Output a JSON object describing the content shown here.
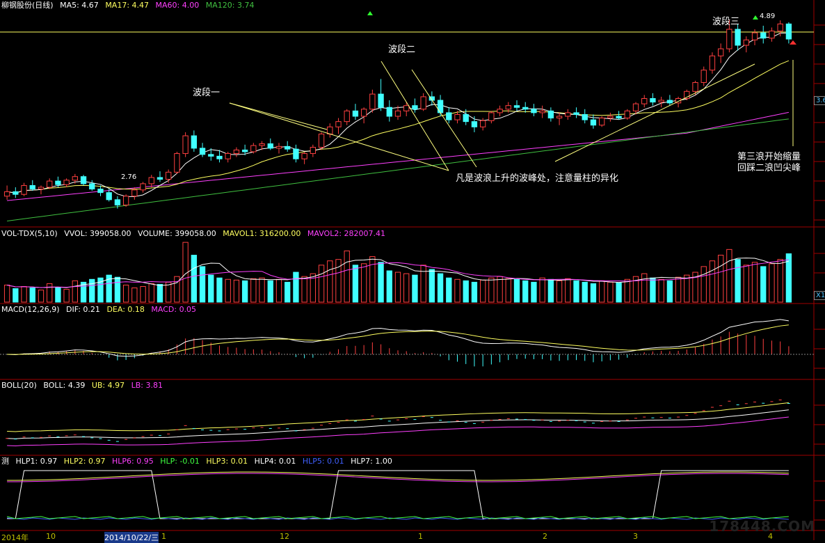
{
  "colors": {
    "up": "#ff4040",
    "down": "#40ffff",
    "ma5": "#ffffff",
    "ma17": "#ffff60",
    "ma60": "#ff40ff",
    "ma120": "#40c040",
    "axis": "#a00000"
  },
  "header": {
    "price": {
      "name": "柳钢股份(日线)",
      "ma5": "MA5: 4.67",
      "ma17": "MA17: 4.47",
      "ma60": "MA60: 4.00",
      "ma120": "MA120: 3.74"
    },
    "vol": {
      "name": "VOL-TDX(5,10)",
      "vvol": "VVOL: 399058.00",
      "volume": "VOLUME: 399058.00",
      "mavol1": "MAVOL1: 316200.00",
      "mavol2": "MAVOL2: 282007.41"
    },
    "macd": {
      "name": "MACD(12,26,9)",
      "dif": "DIF: 0.21",
      "dea": "DEA: 0.18",
      "macd": "MACD: 0.05"
    },
    "boll": {
      "name": "BOLL(20)",
      "boll": "BOLL: 4.39",
      "ub": "UB: 4.97",
      "lb": "LB: 3.81"
    },
    "hlp": {
      "name": "测",
      "hlp1": "HLP1: 0.97",
      "hlp2": "HLP2: 0.97",
      "hlp6": "HLP6: 0.95",
      "hlp": "HLP: -0.01",
      "hlp3": "HLP3: 0.01",
      "hlp4": "HLP4: 0.01",
      "hlp5": "HLP5: 0.01",
      "hlp7": "HLP7: 1.00"
    }
  },
  "annotations": {
    "wave1": "波段一",
    "wave2": "波段二",
    "wave3": "波段三",
    "note_main": "凡是波浪上升的波峰处，注意量柱的异化",
    "note_right_1": "第三浪开始缩量",
    "note_right_2": "回踩二浪凹尖峰",
    "low_label": "2.76",
    "high_label": "4.89"
  },
  "right_tags": {
    "price": "3.6",
    "vol": "X1"
  },
  "x_labels": [
    "2014年",
    "10",
    "2014/10/22/三",
    "1",
    "12",
    "1",
    "2",
    "3",
    "4"
  ],
  "watermark": "178448.COM",
  "chart_data": {
    "type": "candlestick",
    "title": "柳钢股份(日线)",
    "ohlc": [
      [
        2.9,
        3.02,
        2.86,
        2.95
      ],
      [
        2.95,
        3.0,
        2.88,
        2.92
      ],
      [
        2.92,
        3.05,
        2.9,
        3.02
      ],
      [
        3.02,
        3.08,
        2.96,
        2.98
      ],
      [
        2.98,
        3.02,
        2.92,
        3.0
      ],
      [
        3.0,
        3.1,
        2.98,
        3.07
      ],
      [
        3.07,
        3.12,
        3.0,
        3.03
      ],
      [
        3.03,
        3.1,
        3.0,
        3.08
      ],
      [
        3.08,
        3.15,
        3.04,
        3.12
      ],
      [
        3.12,
        3.14,
        3.02,
        3.04
      ],
      [
        3.04,
        3.08,
        2.96,
        2.98
      ],
      [
        2.98,
        3.02,
        2.9,
        2.94
      ],
      [
        2.94,
        2.98,
        2.84,
        2.86
      ],
      [
        2.86,
        2.9,
        2.76,
        2.8
      ],
      [
        2.8,
        2.92,
        2.78,
        2.9
      ],
      [
        2.9,
        3.0,
        2.86,
        2.97
      ],
      [
        2.97,
        3.06,
        2.94,
        3.04
      ],
      [
        3.04,
        3.14,
        3.0,
        3.11
      ],
      [
        3.11,
        3.18,
        3.06,
        3.09
      ],
      [
        3.09,
        3.2,
        3.05,
        3.17
      ],
      [
        3.17,
        3.4,
        3.15,
        3.38
      ],
      [
        3.38,
        3.62,
        3.34,
        3.58
      ],
      [
        3.58,
        3.64,
        3.4,
        3.44
      ],
      [
        3.44,
        3.5,
        3.34,
        3.37
      ],
      [
        3.37,
        3.44,
        3.3,
        3.35
      ],
      [
        3.35,
        3.42,
        3.28,
        3.32
      ],
      [
        3.32,
        3.4,
        3.28,
        3.38
      ],
      [
        3.38,
        3.45,
        3.34,
        3.42
      ],
      [
        3.42,
        3.48,
        3.36,
        3.4
      ],
      [
        3.4,
        3.5,
        3.38,
        3.47
      ],
      [
        3.47,
        3.52,
        3.42,
        3.49
      ],
      [
        3.49,
        3.55,
        3.42,
        3.44
      ],
      [
        3.44,
        3.5,
        3.38,
        3.46
      ],
      [
        3.46,
        3.52,
        3.4,
        3.43
      ],
      [
        3.43,
        3.48,
        3.28,
        3.32
      ],
      [
        3.32,
        3.4,
        3.26,
        3.38
      ],
      [
        3.38,
        3.48,
        3.34,
        3.45
      ],
      [
        3.45,
        3.62,
        3.42,
        3.6
      ],
      [
        3.6,
        3.72,
        3.56,
        3.68
      ],
      [
        3.68,
        3.78,
        3.6,
        3.74
      ],
      [
        3.74,
        3.88,
        3.7,
        3.86
      ],
      [
        3.86,
        3.94,
        3.76,
        3.8
      ],
      [
        3.8,
        3.9,
        3.72,
        3.88
      ],
      [
        3.88,
        4.1,
        3.84,
        4.05
      ],
      [
        4.05,
        4.22,
        3.86,
        3.9
      ],
      [
        3.9,
        3.98,
        3.74,
        3.8
      ],
      [
        3.8,
        3.92,
        3.76,
        3.86
      ],
      [
        3.86,
        3.96,
        3.8,
        3.92
      ],
      [
        3.92,
        4.0,
        3.84,
        3.88
      ],
      [
        3.88,
        4.06,
        3.86,
        4.02
      ],
      [
        4.02,
        4.08,
        3.92,
        3.98
      ],
      [
        3.98,
        4.04,
        3.8,
        3.84
      ],
      [
        3.84,
        3.9,
        3.72,
        3.76
      ],
      [
        3.76,
        3.86,
        3.72,
        3.82
      ],
      [
        3.82,
        3.88,
        3.7,
        3.74
      ],
      [
        3.74,
        3.8,
        3.62,
        3.68
      ],
      [
        3.68,
        3.78,
        3.64,
        3.75
      ],
      [
        3.75,
        3.86,
        3.72,
        3.84
      ],
      [
        3.84,
        3.92,
        3.8,
        3.88
      ],
      [
        3.88,
        3.96,
        3.84,
        3.92
      ],
      [
        3.92,
        3.98,
        3.86,
        3.9
      ],
      [
        3.9,
        3.96,
        3.84,
        3.88
      ],
      [
        3.88,
        3.94,
        3.8,
        3.84
      ],
      [
        3.84,
        3.92,
        3.78,
        3.86
      ],
      [
        3.86,
        3.9,
        3.74,
        3.78
      ],
      [
        3.78,
        3.84,
        3.7,
        3.8
      ],
      [
        3.8,
        3.88,
        3.76,
        3.84
      ],
      [
        3.84,
        3.9,
        3.78,
        3.82
      ],
      [
        3.82,
        3.88,
        3.72,
        3.76
      ],
      [
        3.76,
        3.82,
        3.66,
        3.7
      ],
      [
        3.7,
        3.8,
        3.68,
        3.78
      ],
      [
        3.78,
        3.84,
        3.74,
        3.8
      ],
      [
        3.8,
        3.86,
        3.76,
        3.78
      ],
      [
        3.78,
        3.88,
        3.76,
        3.86
      ],
      [
        3.86,
        3.96,
        3.82,
        3.94
      ],
      [
        3.94,
        4.04,
        3.9,
        4.0
      ],
      [
        4.0,
        4.06,
        3.92,
        3.96
      ],
      [
        3.96,
        4.02,
        3.9,
        3.98
      ],
      [
        3.98,
        4.04,
        3.92,
        3.95
      ],
      [
        3.95,
        4.02,
        3.9,
        4.0
      ],
      [
        4.0,
        4.1,
        3.98,
        4.08
      ],
      [
        4.08,
        4.2,
        4.04,
        4.18
      ],
      [
        4.18,
        4.36,
        4.14,
        4.32
      ],
      [
        4.32,
        4.52,
        4.28,
        4.48
      ],
      [
        4.48,
        4.62,
        4.4,
        4.56
      ],
      [
        4.56,
        4.89,
        4.52,
        4.78
      ],
      [
        4.78,
        4.84,
        4.54,
        4.6
      ],
      [
        4.6,
        4.7,
        4.52,
        4.66
      ],
      [
        4.66,
        4.78,
        4.6,
        4.74
      ],
      [
        4.74,
        4.82,
        4.62,
        4.68
      ],
      [
        4.68,
        4.8,
        4.64,
        4.76
      ],
      [
        4.76,
        4.88,
        4.7,
        4.84
      ],
      [
        4.84,
        4.86,
        4.62,
        4.67
      ]
    ],
    "volume_values": [
      120,
      95,
      110,
      100,
      85,
      130,
      105,
      90,
      150,
      140,
      160,
      170,
      190,
      175,
      120,
      100,
      110,
      130,
      125,
      140,
      180,
      420,
      330,
      250,
      190,
      170,
      160,
      155,
      150,
      165,
      170,
      150,
      160,
      140,
      210,
      180,
      200,
      260,
      290,
      300,
      360,
      260,
      270,
      320,
      280,
      220,
      210,
      200,
      190,
      260,
      230,
      200,
      170,
      160,
      150,
      140,
      155,
      170,
      180,
      165,
      160,
      150,
      140,
      170,
      160,
      150,
      165,
      150,
      140,
      130,
      150,
      140,
      135,
      160,
      180,
      200,
      170,
      160,
      150,
      175,
      190,
      210,
      250,
      290,
      330,
      370,
      300,
      260,
      280,
      250,
      270,
      300,
      340
    ],
    "ylim": [
      2.6,
      5.0
    ],
    "volume_label": "VOL-TDX(5,10)",
    "macd_label": "MACD(12,26,9)",
    "boll_label": "BOLL(20)"
  }
}
